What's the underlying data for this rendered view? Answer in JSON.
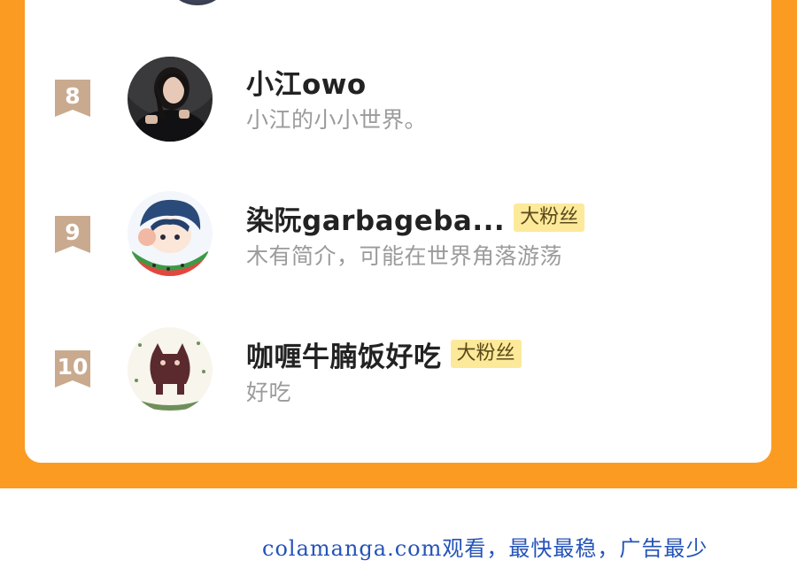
{
  "colors": {
    "accent": "#fb9b22",
    "rank_badge": "#c9aa8e",
    "badge_bg": "#fde99a",
    "footer_link": "#2453b8"
  },
  "ranking": [
    {
      "rank": "8",
      "name": "小江owo",
      "badge": "",
      "description": "小江的小小世界。",
      "avatar": "girl-photo-avatar"
    },
    {
      "rank": "9",
      "name": "染阮garbageba...",
      "badge": "大粉丝",
      "description": "木有简介，可能在世界角落游荡",
      "avatar": "anime-watermelon-avatar"
    },
    {
      "rank": "10",
      "name": "咖喱牛腩饭好吃",
      "badge": "大粉丝",
      "description": "好吃",
      "avatar": "boom-boom-cat-avatar"
    }
  ],
  "footer": {
    "text": "colamanga.com观看，最快最稳，广告最少"
  }
}
